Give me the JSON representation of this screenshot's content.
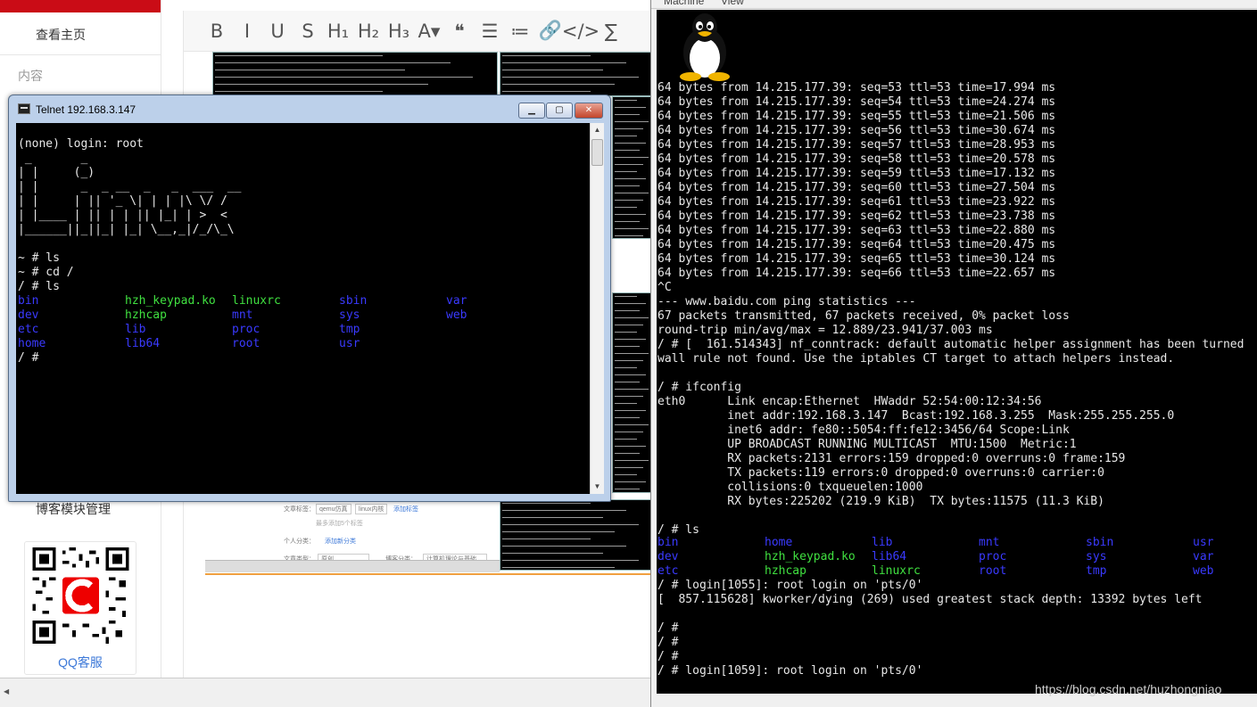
{
  "sidebar": {
    "home_label": "查看主页",
    "content_label": "内容",
    "module_label": "博客模块管理",
    "qq_label": "QQ客服"
  },
  "toolbar": {
    "buttons": [
      {
        "name": "bold-button",
        "glyph": "B"
      },
      {
        "name": "italic-button",
        "glyph": "I"
      },
      {
        "name": "underline-button",
        "glyph": "U"
      },
      {
        "name": "strikethrough-button",
        "glyph": "S"
      },
      {
        "name": "heading1-button",
        "glyph": "H₁"
      },
      {
        "name": "heading2-button",
        "glyph": "H₂"
      },
      {
        "name": "heading3-button",
        "glyph": "H₃"
      },
      {
        "name": "font-color-button",
        "glyph": "A▾"
      },
      {
        "name": "quote-button",
        "glyph": "❝"
      },
      {
        "name": "ordered-list-button",
        "glyph": "☰"
      },
      {
        "name": "unordered-list-button",
        "glyph": "≔"
      },
      {
        "name": "link-button",
        "glyph": "🔗"
      },
      {
        "name": "code-button",
        "glyph": "</>"
      },
      {
        "name": "formula-button",
        "glyph": "∑"
      }
    ]
  },
  "thumb_form": {
    "tags_label": "文章标签：",
    "tag1": "qemu仿真",
    "tag2": "linux内核",
    "add_tag": "添加标签",
    "hint": "最多添加5个标签",
    "category_label": "个人分类：",
    "add_category": "添加新分类",
    "type_label": "文章类型：",
    "type_value": "原创",
    "blog_category_label": "博客分类：",
    "blog_category_value": "计算机理论与基础"
  },
  "telnet": {
    "title": "Telnet 192.168.3.147",
    "min_label": "▁",
    "max_label": "▢",
    "close_label": "✕",
    "lines": [
      "(none) login: root",
      " _       _",
      "| |     (_)",
      "| |      _  _ __  _   _  ___  __",
      "| |     | || '_ \\| | | |\\ \\/ /",
      "| |____ | || | | || |_| | >  <",
      "|______||_||_| |_| \\__,_|/_/\\_\\",
      "",
      "~ # ls",
      "~ # cd /",
      "/ # ls"
    ],
    "ls": [
      {
        "t": "bin",
        "c": "blue"
      },
      {
        "t": "hzh_keypad.ko",
        "c": "green"
      },
      {
        "t": "linuxrc",
        "c": "green"
      },
      {
        "t": "sbin",
        "c": "blue"
      },
      {
        "t": "var",
        "c": "blue"
      },
      {
        "t": "dev",
        "c": "blue"
      },
      {
        "t": "hzhcap",
        "c": "green"
      },
      {
        "t": "mnt",
        "c": "blue"
      },
      {
        "t": "sys",
        "c": "blue"
      },
      {
        "t": "web",
        "c": "blue"
      },
      {
        "t": "etc",
        "c": "blue"
      },
      {
        "t": "lib",
        "c": "blue"
      },
      {
        "t": "proc",
        "c": "blue"
      },
      {
        "t": "tmp",
        "c": "blue"
      },
      {
        "t": "",
        "c": ""
      },
      {
        "t": "home",
        "c": "blue"
      },
      {
        "t": "lib64",
        "c": "blue"
      },
      {
        "t": "root",
        "c": "blue"
      },
      {
        "t": "usr",
        "c": "blue"
      },
      {
        "t": "",
        "c": ""
      }
    ],
    "prompt": "/ #"
  },
  "qemu": {
    "menu": [
      "Machine",
      "View"
    ],
    "lines": [
      "64 bytes from 14.215.177.39: seq=53 ttl=53 time=17.994 ms",
      "64 bytes from 14.215.177.39: seq=54 ttl=53 time=24.274 ms",
      "64 bytes from 14.215.177.39: seq=55 ttl=53 time=21.506 ms",
      "64 bytes from 14.215.177.39: seq=56 ttl=53 time=30.674 ms",
      "64 bytes from 14.215.177.39: seq=57 ttl=53 time=28.953 ms",
      "64 bytes from 14.215.177.39: seq=58 ttl=53 time=20.578 ms",
      "64 bytes from 14.215.177.39: seq=59 ttl=53 time=17.132 ms",
      "64 bytes from 14.215.177.39: seq=60 ttl=53 time=27.504 ms",
      "64 bytes from 14.215.177.39: seq=61 ttl=53 time=23.922 ms",
      "64 bytes from 14.215.177.39: seq=62 ttl=53 time=23.738 ms",
      "64 bytes from 14.215.177.39: seq=63 ttl=53 time=22.880 ms",
      "64 bytes from 14.215.177.39: seq=64 ttl=53 time=20.475 ms",
      "64 bytes from 14.215.177.39: seq=65 ttl=53 time=30.124 ms",
      "64 bytes from 14.215.177.39: seq=66 ttl=53 time=22.657 ms",
      "^C",
      "--- www.baidu.com ping statistics ---",
      "67 packets transmitted, 67 packets received, 0% packet loss",
      "round-trip min/avg/max = 12.889/23.941/37.003 ms",
      "/ # [  161.514343] nf_conntrack: default automatic helper assignment has been turned",
      "wall rule not found. Use the iptables CT target to attach helpers instead.",
      "",
      "/ # ifconfig",
      "eth0      Link encap:Ethernet  HWaddr 52:54:00:12:34:56",
      "          inet addr:192.168.3.147  Bcast:192.168.3.255  Mask:255.255.255.0",
      "          inet6 addr: fe80::5054:ff:fe12:3456/64 Scope:Link",
      "          UP BROADCAST RUNNING MULTICAST  MTU:1500  Metric:1",
      "          RX packets:2131 errors:159 dropped:0 overruns:0 frame:159",
      "          TX packets:119 errors:0 dropped:0 overruns:0 carrier:0",
      "          collisions:0 txqueuelen:1000",
      "          RX bytes:225202 (219.9 KiB)  TX bytes:11575 (11.3 KiB)",
      "",
      "/ # ls"
    ],
    "ls": [
      {
        "t": "bin",
        "c": "blue"
      },
      {
        "t": "home",
        "c": "blue"
      },
      {
        "t": "lib",
        "c": "blue"
      },
      {
        "t": "mnt",
        "c": "blue"
      },
      {
        "t": "sbin",
        "c": "blue"
      },
      {
        "t": "usr",
        "c": "blue"
      },
      {
        "t": "dev",
        "c": "blue"
      },
      {
        "t": "hzh_keypad.ko",
        "c": "green"
      },
      {
        "t": "lib64",
        "c": "blue"
      },
      {
        "t": "proc",
        "c": "blue"
      },
      {
        "t": "sys",
        "c": "blue"
      },
      {
        "t": "var",
        "c": "blue"
      },
      {
        "t": "etc",
        "c": "blue"
      },
      {
        "t": "hzhcap",
        "c": "green"
      },
      {
        "t": "linuxrc",
        "c": "green"
      },
      {
        "t": "root",
        "c": "blue"
      },
      {
        "t": "tmp",
        "c": "blue"
      },
      {
        "t": "web",
        "c": "blue"
      }
    ],
    "tail": [
      "/ # login[1055]: root login on 'pts/0'",
      "[  857.115628] kworker/dying (269) used greatest stack depth: 13392 bytes left",
      "",
      "/ #",
      "/ #",
      "/ #",
      "/ # login[1059]: root login on 'pts/0'"
    ]
  },
  "watermark": "https://blog.csdn.net/huzhongniao",
  "colors": {
    "brand_red": "#ca0c16",
    "dir_blue": "#3a3aff",
    "exec_green": "#40e040"
  }
}
